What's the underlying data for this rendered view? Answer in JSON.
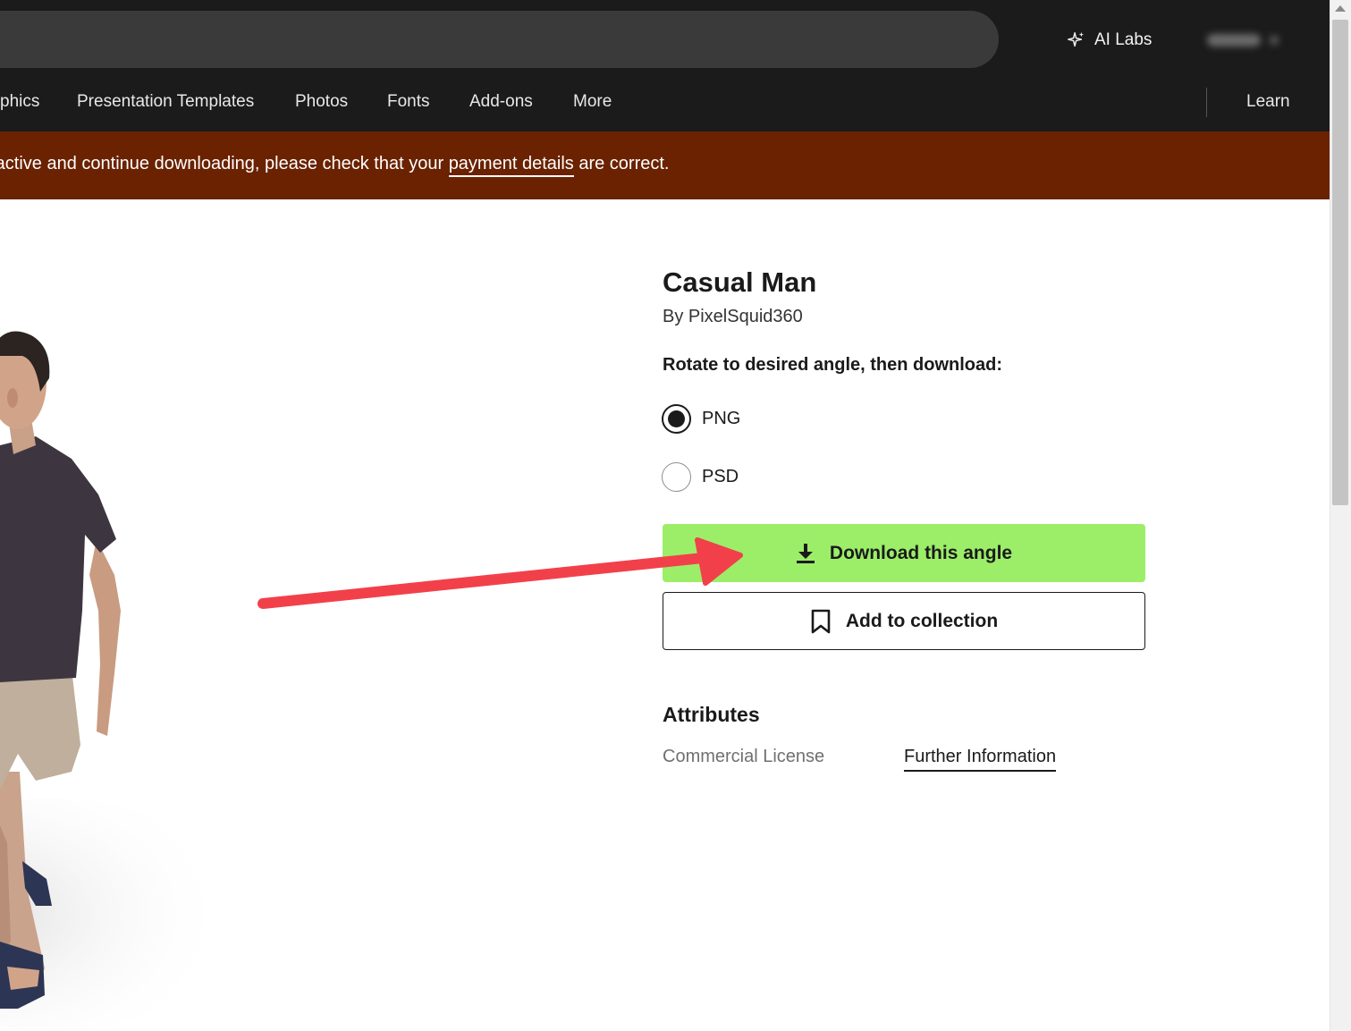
{
  "header": {
    "ai_labs_label": "AI Labs",
    "account_label": "Yearly"
  },
  "nav": {
    "items": [
      {
        "label": "phics"
      },
      {
        "label": "Presentation Templates"
      },
      {
        "label": "Photos"
      },
      {
        "label": "Fonts"
      },
      {
        "label": "Add-ons"
      },
      {
        "label": "More"
      }
    ],
    "learn_label": "Learn"
  },
  "banner": {
    "text_before": "n active and continue downloading, please check that your ",
    "link_text": "payment details",
    "text_after": " are correct.",
    "background": "#6a2200"
  },
  "product": {
    "title": "Casual Man",
    "author": "By PixelSquid360",
    "instruction": "Rotate to desired angle, then download:",
    "formats": [
      {
        "label": "PNG",
        "selected": true
      },
      {
        "label": "PSD",
        "selected": false
      }
    ],
    "download_button": "Download this angle",
    "collection_button": "Add to collection",
    "download_color": "#9cee69"
  },
  "attributes": {
    "heading": "Attributes",
    "license": "Commercial License",
    "further_info": "Further Information"
  },
  "annotation": {
    "arrow_color": "#f2404a"
  }
}
